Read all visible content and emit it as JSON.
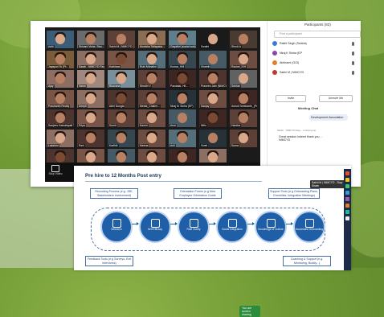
{
  "zoom": {
    "participants_title": "Participants (83)",
    "find_placeholder": "Find a participant",
    "participants": [
      {
        "name": "Rakhi Singh (Swaha)",
        "color": "#3a7bd5"
      },
      {
        "name": "Niraj K Sinha (EP",
        "color": "#8e44ad"
      },
      {
        "name": "Abhirami (GOI)",
        "color": "#e67e22"
      },
      {
        "name": "Sakhi M | NIMCYD",
        "color": "#c0392b"
      }
    ],
    "invite_label": "Invite",
    "unmute_label": "Unmute Me",
    "chat_title": "Meeting Chat",
    "chat_bubble": "Development Association",
    "chat_meta": "Sarah - NIMCYD Reg... to Everyone",
    "chat_message": "Great session indeed thank you ... NIMCYD",
    "chat_prompt": "Who can see your messages? Recording o...",
    "tiles": [
      {
        "name": "Aditi",
        "face": "light",
        "hair": true,
        "bg": "#3b5d77"
      },
      {
        "name": "Shivani Vishe, Siso...",
        "face": "mid",
        "hair": true,
        "bg": "#6b6b6b"
      },
      {
        "name": "Sakhi M | NIMCYD",
        "face": "mid",
        "hair": false,
        "bg": "#5d4037"
      },
      {
        "name": "Monisha Tallapaka...",
        "face": "light",
        "hair": true,
        "bg": "#8a6d52"
      },
      {
        "name": "Gayathri (social wok)",
        "face": "mid",
        "hair": true,
        "bg": "#607d8b"
      },
      {
        "name": "Swathi",
        "face": "light",
        "hair": false,
        "bg": "#1a1a1a"
      },
      {
        "name": "Shruti.A",
        "face": "mid",
        "hair": false,
        "bg": "#4a3b32"
      },
      {
        "name": "Jayapuri Sr (Pr...",
        "face": "mid",
        "hair": true,
        "bg": "#7a5c3a"
      },
      {
        "name": "Sarah - NIMCYD Rege...",
        "face": "light",
        "hair": true,
        "bg": "#8d6e63"
      },
      {
        "name": "Karkhwa",
        "face": "dark",
        "hair": true,
        "bg": "#795548"
      },
      {
        "name": "Ruhi Mrinalini",
        "face": "light",
        "hair": true,
        "bg": "#546e7a"
      },
      {
        "name": "Kumar_HM",
        "face": "mid",
        "hair": true,
        "bg": "#37474f"
      },
      {
        "name": "Vineeth",
        "face": "mid",
        "hair": false,
        "bg": "#455a64"
      },
      {
        "name": "Rachel_IVH",
        "face": "light",
        "hair": true,
        "bg": "#6d4c41"
      },
      {
        "name": "Ajay",
        "face": "mid",
        "hair": true,
        "bg": "#8d6e63"
      },
      {
        "name": "Varun",
        "face": "light",
        "hair": true,
        "bg": "#a1887f"
      },
      {
        "name": "Bhavana",
        "face": "light",
        "hair": true,
        "bg": "#78909c"
      },
      {
        "name": "Shruthi V",
        "face": "mid",
        "hair": true,
        "bg": "#5d4037"
      },
      {
        "name": "Pandalai, HK...",
        "face": "dark",
        "hair": true,
        "bg": "#3e2723"
      },
      {
        "name": "Praveen Jain (NIMCYD...)",
        "face": "mid",
        "hair": true,
        "bg": "#4e342e"
      },
      {
        "name": "Sekhar",
        "face": "light",
        "hair": false,
        "bg": "#616161"
      },
      {
        "name": "Prashanth Reddy",
        "face": "mid",
        "hair": true,
        "bg": "#795548"
      },
      {
        "name": "Deepti",
        "face": "light",
        "hair": true,
        "bg": "#8d6e63"
      },
      {
        "name": "Abhi Dungla",
        "face": "dark",
        "hair": true,
        "bg": "#4e342e"
      },
      {
        "name": "Meeta_Chairm...",
        "face": "mid",
        "hair": true,
        "bg": "#5d4037"
      },
      {
        "name": "Niraj Kr Sinha (EP)",
        "face": "mid",
        "hair": true,
        "bg": "#263238"
      },
      {
        "name": "Sanjay",
        "face": "light",
        "hair": true,
        "bg": "#6d4c41"
      },
      {
        "name": "Ashok Sreekanth_(Prem...)",
        "face": "mid",
        "hair": true,
        "bg": "#3e2723"
      },
      {
        "name": "Sanjeev Kamalapati Tu...",
        "face": "mid",
        "hair": true,
        "bg": "#4e342e"
      },
      {
        "name": "Priya",
        "face": "light",
        "hair": true,
        "bg": "#795548"
      },
      {
        "name": "Sumit",
        "face": "mid",
        "hair": true,
        "bg": "#5d4037"
      },
      {
        "name": "Kaveri",
        "face": "light",
        "hair": true,
        "bg": "#6d4c41"
      },
      {
        "name": "Arun",
        "face": "mid",
        "hair": false,
        "bg": "#455a64"
      },
      {
        "name": "Nitin",
        "face": "dark",
        "hair": true,
        "bg": "#3e2723"
      },
      {
        "name": "Harsha",
        "face": "mid",
        "hair": true,
        "bg": "#5d4037"
      },
      {
        "name": "Lakshmi",
        "face": "light",
        "hair": true,
        "bg": "#8d6e63"
      },
      {
        "name": "Ravi",
        "face": "mid",
        "hair": true,
        "bg": "#4e342e"
      },
      {
        "name": "Karthik",
        "face": "mid",
        "hair": true,
        "bg": "#37474f"
      },
      {
        "name": "Meena",
        "face": "light",
        "hair": true,
        "bg": "#6d4c41"
      },
      {
        "name": "Anil",
        "face": "mid",
        "hair": true,
        "bg": "#546e7a"
      },
      {
        "name": "Vivek",
        "face": "mid",
        "hair": false,
        "bg": "#263238"
      },
      {
        "name": "Suma",
        "face": "light",
        "hair": true,
        "bg": "#5d4037"
      },
      {
        "name": "Deepak",
        "face": "dark",
        "hair": true,
        "bg": "#4e342e"
      },
      {
        "name": "Nandita",
        "face": "light",
        "hair": true,
        "bg": "#795548"
      },
      {
        "name": "Gopal",
        "face": "mid",
        "hair": true,
        "bg": "#455a64"
      },
      {
        "name": "Rekha",
        "face": "light",
        "hair": true,
        "bg": "#6d4c41"
      },
      {
        "name": "Manoj",
        "face": "mid",
        "hair": true,
        "bg": "#3e2723"
      },
      {
        "name": "Sunita",
        "face": "light",
        "hair": true,
        "bg": "#8d6e63"
      }
    ],
    "bottom_bar": {
      "stop_video": "Stop Video",
      "share_label": "You are screen sharing"
    },
    "view_label": "View",
    "tooltip": "Sakhi M | NIMCYD - Stop Share"
  },
  "slide": {
    "title": "Pre hire to 12 Months Post entry",
    "top_boxes": [
      "Recruiting Process (e.g. JDE, Stakeholders involvement)",
      "Orientation Forms (e.g New Employee Orientation Guide",
      "Support Tools (e.g Onboarding Plans, Checklists, Integration Meetings)"
    ],
    "bottom_boxes": [
      "Feedback Tools (e.g Surveys, Exit Interviews)",
      "Coaching & Support (e.g. Mentoring, Buddy...)"
    ],
    "stages": [
      {
        "label": "Selection"
      },
      {
        "label": "Self Efficacy"
      },
      {
        "label": "Role Clarity"
      },
      {
        "label": "Social Integration"
      },
      {
        "label": "Knowledge of Culture"
      },
      {
        "label": "Successful Onboarding"
      }
    ]
  },
  "colors": {
    "background": "#6f9a34",
    "accent": "#1f5fa8",
    "slide_text": "#1d3557"
  }
}
